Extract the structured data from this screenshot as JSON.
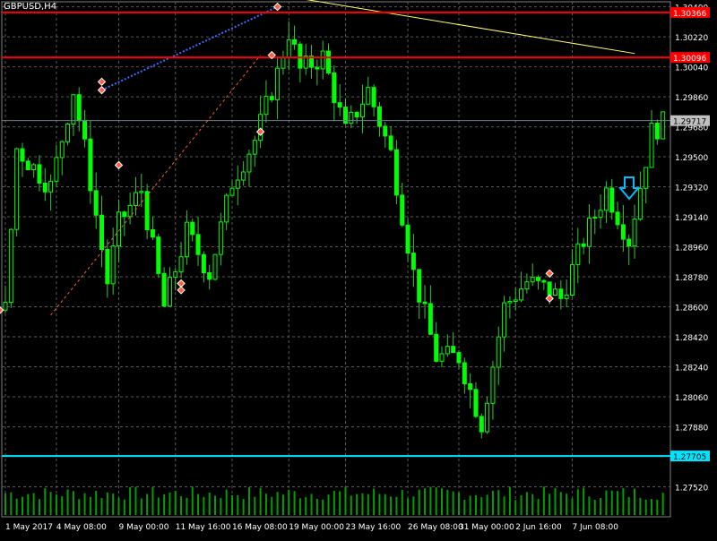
{
  "header": {
    "symbol": "GBPUSD,H4"
  },
  "colors": {
    "background": "#000000",
    "grid": "#5a5a5a",
    "candle_body": "#00ff00",
    "candle_wick": "#32c832",
    "support_line": "#00e5ff",
    "resistance_line": "#ff0000",
    "trendline": "#ffff66",
    "volume": "#00a000",
    "arrow": "#00bfff",
    "current_price_line": "#708090"
  },
  "chart_data": {
    "type": "candlestick",
    "title": "GBPUSD,H4",
    "ylim": [
      1.2734,
      1.3043
    ],
    "y_ticks": [
      "1.30400",
      "1.30220",
      "1.30040",
      "1.29860",
      "1.29680",
      "1.29500",
      "1.29320",
      "1.29140",
      "1.28960",
      "1.28780",
      "1.28600",
      "1.28420",
      "1.28240",
      "1.28060",
      "1.27880",
      "1.27520"
    ],
    "x_tick_labels": [
      "1 May 2017",
      "4 May 08:00",
      "9 May 00:00",
      "11 May 16:00",
      "16 May 08:00",
      "19 May 00:00",
      "23 May 16:00",
      "26 May 08:00",
      "31 May 00:00",
      "2 Jun 16:00",
      "7 Jun 08:00"
    ],
    "levels": [
      {
        "name": "resistance-high",
        "price": 1.30366,
        "label": "1.30366",
        "style": "red"
      },
      {
        "name": "resistance-low",
        "price": 1.30096,
        "label": "1.30096",
        "style": "red"
      },
      {
        "name": "current-price",
        "price": 1.29717,
        "label": "1.29717",
        "style": "gray"
      },
      {
        "name": "support",
        "price": 1.27705,
        "label": "1.27705",
        "style": "cyan"
      }
    ],
    "anchors": [
      [
        0,
        1.2858
      ],
      [
        2,
        1.2955
      ],
      [
        8,
        1.2932
      ],
      [
        12,
        1.299
      ],
      [
        14,
        1.2955
      ],
      [
        18,
        1.2875
      ],
      [
        20,
        1.291
      ],
      [
        24,
        1.293
      ],
      [
        28,
        1.286
      ],
      [
        32,
        1.2905
      ],
      [
        36,
        1.288
      ],
      [
        40,
        1.2935
      ],
      [
        44,
        1.296
      ],
      [
        48,
        1.3
      ],
      [
        50,
        1.3025
      ],
      [
        52,
        1.3002
      ],
      [
        56,
        1.301
      ],
      [
        60,
        1.2965
      ],
      [
        64,
        1.299
      ],
      [
        68,
        1.2952
      ],
      [
        72,
        1.288
      ],
      [
        76,
        1.283
      ],
      [
        80,
        1.283
      ],
      [
        84,
        1.279
      ],
      [
        88,
        1.286
      ],
      [
        92,
        1.2875
      ],
      [
        96,
        1.287
      ],
      [
        98,
        1.2865
      ],
      [
        102,
        1.29
      ],
      [
        106,
        1.293
      ],
      [
        110,
        1.29
      ],
      [
        114,
        1.2965
      ],
      [
        116,
        1.297
      ]
    ],
    "candle_count": 117,
    "trendlines": [
      {
        "from": [
          34,
          1.3055
        ],
        "to": [
          111,
          1.3012
        ],
        "color": "yellow"
      },
      {
        "from": [
          17,
          1.299
        ],
        "to": [
          48,
          1.304
        ],
        "color": "blue"
      },
      {
        "from": [
          8,
          1.2855
        ],
        "to": [
          45,
          1.3011
        ],
        "color": "red"
      }
    ],
    "annotations": "entry/exit markers and a short-signal down arrow",
    "arrow_signal": "down"
  }
}
